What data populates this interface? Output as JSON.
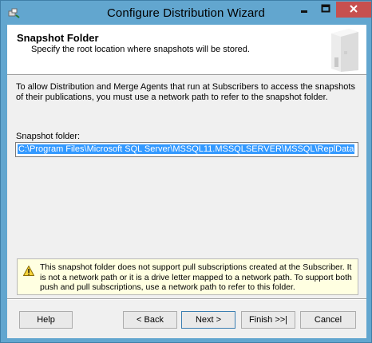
{
  "window": {
    "title": "Configure Distribution Wizard",
    "app_icon": "wizard-icon",
    "close_color": "#c7504f"
  },
  "header": {
    "title": "Snapshot Folder",
    "subtitle": "Specify the root location where snapshots will be stored.",
    "art_icon": "server-icon"
  },
  "intro_text": "To allow Distribution and Merge Agents that run at Subscribers to access the snapshots of their publications, you must use a network path to refer to the snapshot folder.",
  "snapshot": {
    "label": "Snapshot folder:",
    "value": "C:\\Program Files\\Microsoft SQL Server\\MSSQL11.MSSQLSERVER\\MSSQL\\ReplData"
  },
  "warning": {
    "icon": "warning-icon",
    "text": "This snapshot folder does not support pull subscriptions created at the Subscriber. It is not a network path or it is a drive letter mapped to a network path. To support both push and pull subscriptions, use a network path to refer to this folder."
  },
  "buttons": {
    "help": "Help",
    "back": "< Back",
    "next": "Next >",
    "finish": "Finish >>|",
    "cancel": "Cancel"
  }
}
